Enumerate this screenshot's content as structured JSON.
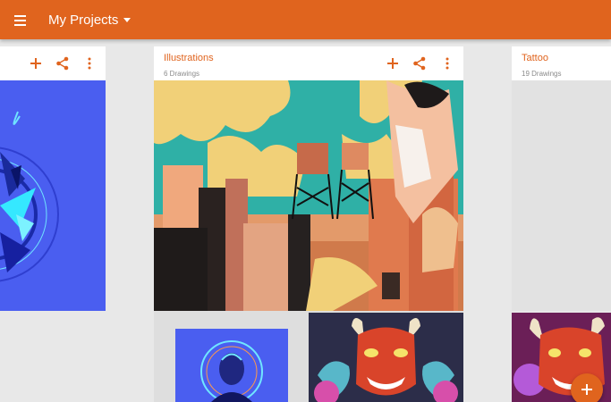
{
  "app_bar": {
    "menu_icon": "hamburger-menu-icon",
    "title": "My Projects",
    "dropdown_icon": "caret-down-icon",
    "background_color": "#e0641e"
  },
  "projects": [
    {
      "name": "",
      "drawings": "",
      "actions": [
        "add-icon",
        "share-icon",
        "more-vertical-icon"
      ]
    },
    {
      "name": "Illustrations",
      "drawings": "6 Drawings",
      "actions": [
        "add-icon",
        "share-icon",
        "more-vertical-icon"
      ]
    },
    {
      "name": "Tattoo",
      "drawings": "19 Drawings"
    }
  ],
  "fab": {
    "icon": "add-icon"
  },
  "colors": {
    "accent": "#e0641e",
    "card": "#ffffff",
    "background": "#e8e8e8",
    "subtitle": "#8a8a8a"
  }
}
